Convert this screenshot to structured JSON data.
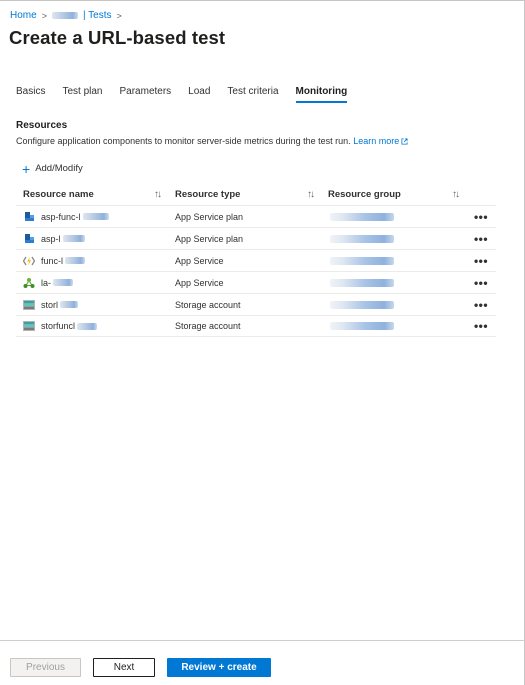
{
  "breadcrumb": {
    "home": "Home",
    "tests": "| Tests",
    "separator": ">"
  },
  "page": {
    "title": "Create a URL-based test"
  },
  "tabs": [
    {
      "label": "Basics",
      "active": false
    },
    {
      "label": "Test plan",
      "active": false
    },
    {
      "label": "Parameters",
      "active": false
    },
    {
      "label": "Load",
      "active": false
    },
    {
      "label": "Test criteria",
      "active": false
    },
    {
      "label": "Monitoring",
      "active": true
    }
  ],
  "resources": {
    "title": "Resources",
    "description": "Configure application components to monitor server-side metrics during the test run.",
    "learn_more": "Learn more",
    "add_modify": "Add/Modify"
  },
  "table": {
    "headers": {
      "name": "Resource name",
      "type": "Resource type",
      "group": "Resource group",
      "sort_icon": "↑↓"
    },
    "more_icon": "•••",
    "rows": [
      {
        "name": "asp-func-l",
        "type": "App Service plan",
        "icon": "app-service-plan-icon"
      },
      {
        "name": "asp-l",
        "type": "App Service plan",
        "icon": "app-service-plan-icon"
      },
      {
        "name": "func-l",
        "type": "App Service",
        "icon": "function-app-icon"
      },
      {
        "name": "la-",
        "type": "App Service",
        "icon": "logic-app-icon"
      },
      {
        "name": "storl",
        "type": "Storage account",
        "icon": "storage-account-icon"
      },
      {
        "name": "storfuncl",
        "type": "Storage account",
        "icon": "storage-account-icon"
      }
    ]
  },
  "footer": {
    "previous": "Previous",
    "next": "Next",
    "review_create": "Review + create"
  },
  "colors": {
    "accent": "#0078d4",
    "text": "#201f1e",
    "disabled": "#a19f9d"
  }
}
